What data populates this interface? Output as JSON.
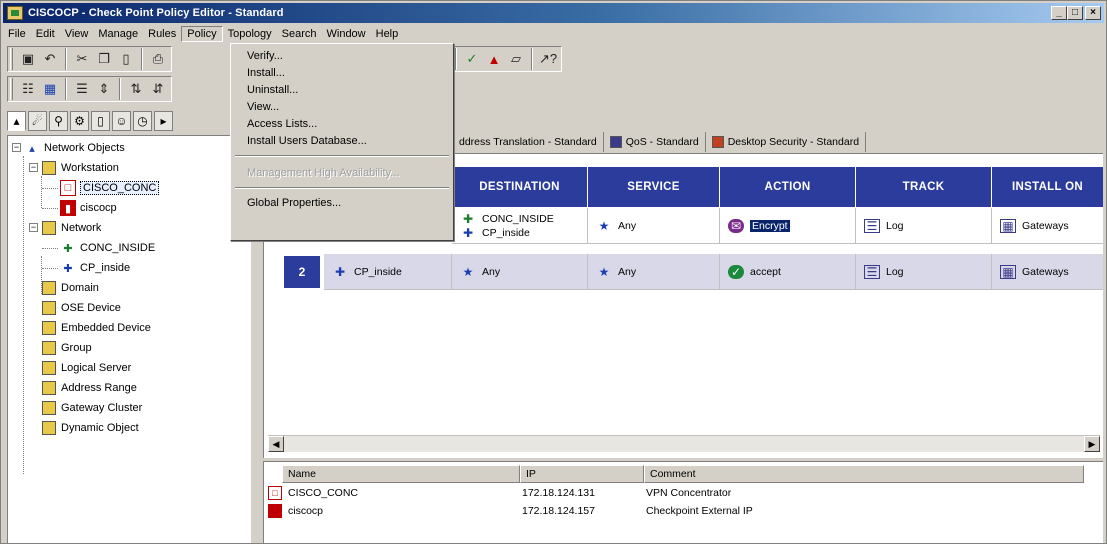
{
  "window": {
    "title": "CISCOCP - Check Point Policy Editor - Standard",
    "controls": {
      "minimize": "_",
      "maximize": "□",
      "close": "×"
    }
  },
  "menubar": [
    "File",
    "Edit",
    "View",
    "Manage",
    "Rules",
    "Policy",
    "Topology",
    "Search",
    "Window",
    "Help"
  ],
  "menubar_open": "Policy",
  "policy_menu": {
    "items": [
      "Verify...",
      "Install...",
      "Uninstall...",
      "View...",
      "Access Lists...",
      "Install Users Database..."
    ],
    "disabled_item": "Management High Availability...",
    "last_item": "Global Properties..."
  },
  "tree": {
    "root": "Network Objects",
    "workstation": "Workstation",
    "workstation_children": [
      "CISCO_CONC",
      "ciscocp"
    ],
    "network": "Network",
    "network_children": [
      "CONC_INSIDE",
      "CP_inside"
    ],
    "others": [
      "Domain",
      "OSE Device",
      "Embedded Device",
      "Group",
      "Logical Server",
      "Address Range",
      "Gateway Cluster",
      "Dynamic Object"
    ]
  },
  "tabs": [
    "ddress Translation - Standard",
    "QoS - Standard",
    "Desktop Security - Standard"
  ],
  "rules": {
    "headers": [
      "DESTINATION",
      "SERVICE",
      "ACTION",
      "TRACK",
      "INSTALL ON"
    ],
    "rows": [
      {
        "number": "",
        "source": "",
        "destination": [
          "CONC_INSIDE",
          "CP_inside"
        ],
        "service": "Any",
        "action": "Encrypt",
        "track": "Log",
        "install_on": "Gateways"
      },
      {
        "number": "2",
        "source": "CP_inside",
        "destination": [
          "Any"
        ],
        "service": "Any",
        "action": "accept",
        "track": "Log",
        "install_on": "Gateways"
      }
    ]
  },
  "objects_list": {
    "headers": [
      "Name",
      "IP",
      "Comment"
    ],
    "rows": [
      {
        "name": "CISCO_CONC",
        "ip": "172.18.124.131",
        "comment": "VPN Concentrator"
      },
      {
        "name": "ciscocp",
        "ip": "172.18.124.157",
        "comment": "Checkpoint External IP"
      }
    ]
  },
  "colors": {
    "header_blue": "#2c3c9c",
    "title_gradient_start": "#0a246a",
    "chrome": "#d4d0c8"
  }
}
